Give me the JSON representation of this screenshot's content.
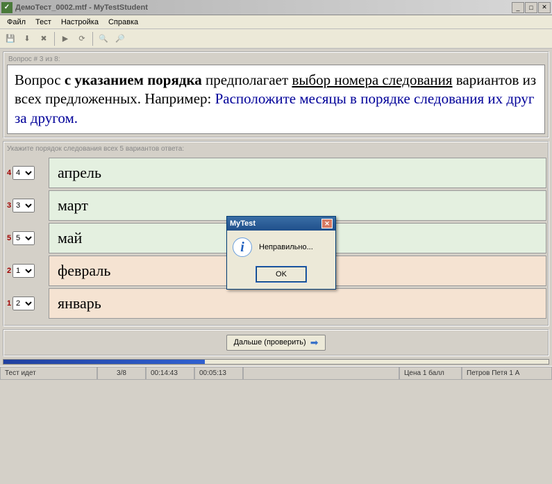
{
  "window": {
    "title": "ДемоТест_0002.mtf - MyTestStudent"
  },
  "menu": {
    "file": "Файл",
    "test": "Тест",
    "settings": "Настройка",
    "help": "Справка"
  },
  "question_panel": {
    "legend": "Вопрос # 3 из 8:",
    "text_part1": "Вопрос ",
    "text_bold": "с указанием порядка",
    "text_part2": " предполагает ",
    "text_underline1": "выбор номера следования",
    "text_part3": " вариантов из всех предложенных. Например: ",
    "text_blue": "Расположите месяцы в порядке следования их друг за другом."
  },
  "options_panel": {
    "legend": "Укажите порядок следования всех 5 вариантов ответа:",
    "rows": [
      {
        "num": "4",
        "sel": "4",
        "text": "апрель",
        "bg": "green"
      },
      {
        "num": "3",
        "sel": "3",
        "text": "март",
        "bg": "green"
      },
      {
        "num": "5",
        "sel": "5",
        "text": "май",
        "bg": "green"
      },
      {
        "num": "2",
        "sel": "1",
        "text": "февраль",
        "bg": "orange"
      },
      {
        "num": "1",
        "sel": "2",
        "text": "январь",
        "bg": "orange"
      }
    ]
  },
  "next_button": "Дальше (проверить)",
  "status": {
    "state": "Тест идет",
    "progress": "3/8",
    "time1": "00:14:43",
    "time2": "00:05:13",
    "spacer": "",
    "score": "Цена 1 балл",
    "student": "Петров Петя 1 А"
  },
  "dialog": {
    "title": "MyTest",
    "message": "Неправильно...",
    "ok": "OK"
  }
}
